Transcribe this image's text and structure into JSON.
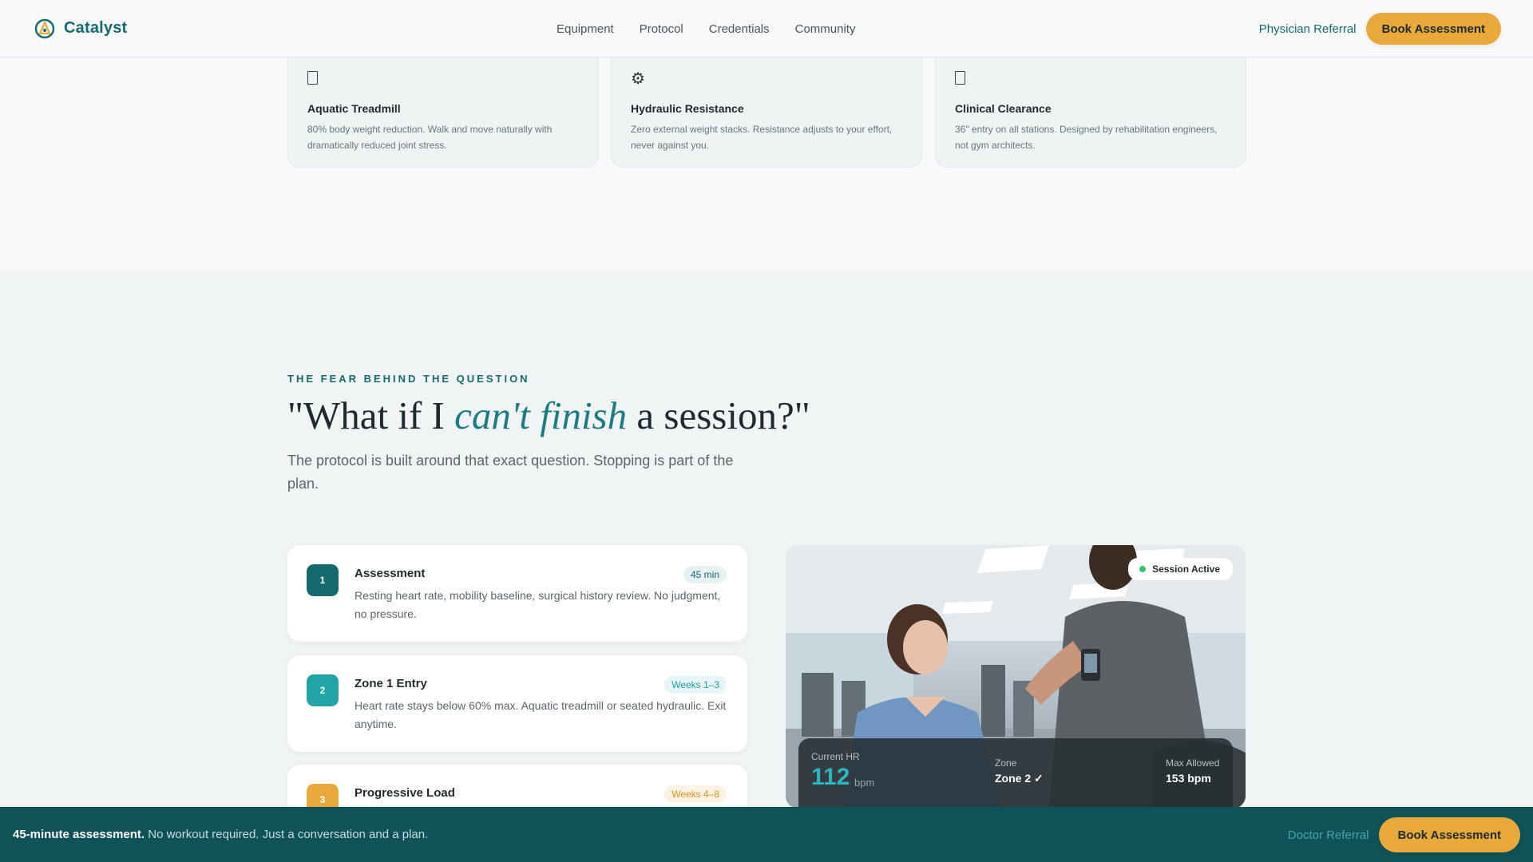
{
  "header": {
    "brand": "Catalyst",
    "nav": [
      "Equipment",
      "Protocol",
      "Credentials",
      "Community"
    ],
    "physician_referral": "Physician Referral",
    "book_assessment": "Book Assessment"
  },
  "features": [
    {
      "icon": "document-icon",
      "title": "Aquatic Treadmill",
      "desc": "80% body weight reduction. Walk and move naturally with dramatically reduced joint stress."
    },
    {
      "icon": "gear-icon",
      "title": "Hydraulic Resistance",
      "desc": "Zero external weight stacks. Resistance adjusts to your effort, never against you."
    },
    {
      "icon": "document-icon",
      "title": "Clinical Clearance",
      "desc": "36\" entry on all stations. Designed by rehabilitation engineers, not gym architects."
    }
  ],
  "fear": {
    "eyebrow": "THE FEAR BEHIND THE QUESTION",
    "headline_pre": "\"What if I ",
    "headline_em": "can't finish",
    "headline_post": " a session?\"",
    "lead": "The protocol is built around that exact question. Stopping is part of the plan."
  },
  "steps": [
    {
      "num": "1",
      "title": "Assessment",
      "pill": "45 min",
      "desc": "Resting heart rate, mobility baseline, surgical history review. No judgment, no pressure.",
      "color": "#156a70"
    },
    {
      "num": "2",
      "title": "Zone 1 Entry",
      "pill": "Weeks 1–3",
      "desc": "Heart rate stays below 60% max. Aquatic treadmill or seated hydraulic. Exit anytime.",
      "color": "#22a3a6"
    },
    {
      "num": "3",
      "title": "Progressive Load",
      "pill": "Weeks 4–8",
      "desc": "",
      "color": "#e9a93a"
    }
  ],
  "session": {
    "badge": "Session Active",
    "current_hr_label": "Current HR",
    "current_hr_value": "112",
    "current_hr_unit": "bpm",
    "zone_label": "Zone",
    "zone_value": "Zone 2 ✓",
    "max_label": "Max Allowed",
    "max_value": "153 bpm"
  },
  "bottom_bar": {
    "strong": "45-minute assessment.",
    "text": " No workout required. Just a conversation and a plan.",
    "doctor_referral": "Doctor Referral",
    "book_assessment": "Book Assessment"
  },
  "colors": {
    "brand_teal": "#156a70",
    "accent_gold": "#e9a93a",
    "bottom_bar_bg": "#0f5258",
    "status_green": "#38c172"
  }
}
